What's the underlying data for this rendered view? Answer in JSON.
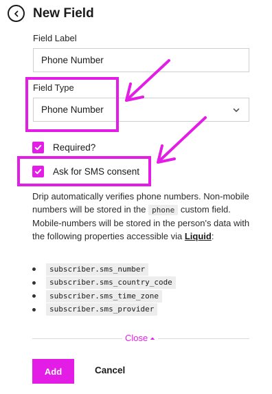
{
  "header": {
    "title": "New Field"
  },
  "field_label": {
    "label": "Field Label",
    "value": "Phone Number"
  },
  "field_type": {
    "label": "Field Type",
    "value": "Phone Number"
  },
  "required": {
    "label": "Required?",
    "checked": true
  },
  "sms_consent": {
    "label": "Ask for SMS consent",
    "checked": true
  },
  "description": {
    "text1": "Drip automatically verifies phone numbers. Non-mobile numbers will be stored in the ",
    "code": "phone",
    "text2": " custom field. Mobile-numbers will be stored in the person's data with the following properties accessible via ",
    "link": "Liquid",
    "text3": ":"
  },
  "properties": [
    "subscriber.sms_number",
    "subscriber.sms_country_code",
    "subscriber.sms_time_zone",
    "subscriber.sms_provider"
  ],
  "close_label": "Close",
  "actions": {
    "add_label": "Add",
    "cancel_label": "Cancel"
  },
  "colors": {
    "accent": "#e41de6",
    "text": "#1a1a1a",
    "border": "#cfcfcf",
    "code_bg": "#ededed"
  }
}
